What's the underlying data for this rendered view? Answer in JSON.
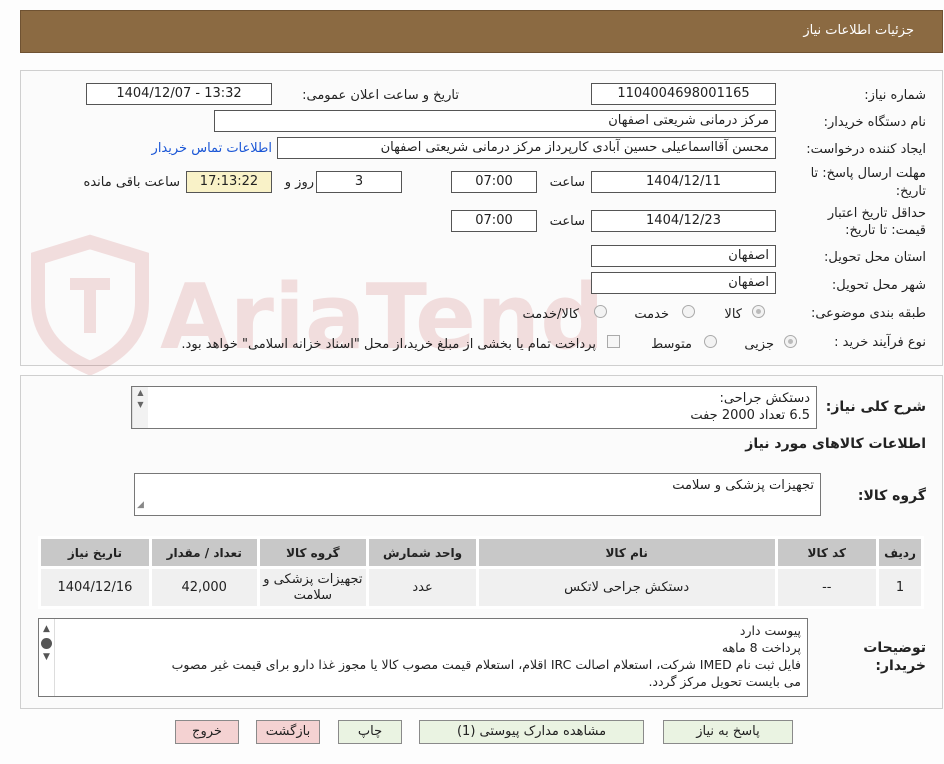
{
  "header": {
    "title": "جزئیات اطلاعات نیاز"
  },
  "watermark": {
    "text": "AriaTender.neT"
  },
  "form": {
    "need_number_label": "شماره نیاز:",
    "need_number": "1104004698001165",
    "announce_label": "تاریخ و ساعت اعلان عمومی:",
    "announce_value": "1404/12/07 - 13:32",
    "buyer_label": "نام دستگاه خریدار:",
    "buyer_value": "مرکز درمانی شریعتی اصفهان",
    "creator_label": "ایجاد کننده درخواست:",
    "creator_value": "محسن آقااسماعیلی حسین آبادی کارپرداز مرکز درمانی شریعتی اصفهان",
    "contact_link": "اطلاعات تماس خریدار",
    "deadline_label_1": "مهلت ارسال پاسخ: تا",
    "deadline_label_2": "تاریخ:",
    "deadline_date": "1404/12/11",
    "time_label": "ساعت",
    "deadline_time": "07:00",
    "days_value": "3",
    "days_label": "روز و",
    "remaining_time": "17:13:22",
    "remaining_label": "ساعت باقی مانده",
    "validity_label_1": "حداقل تاریخ اعتبار",
    "validity_label_2": "قیمت: تا تاریخ:",
    "validity_date": "1404/12/23",
    "validity_time": "07:00",
    "province_label": "استان محل تحویل:",
    "province_value": "اصفهان",
    "city_label": "شهر محل تحویل:",
    "city_value": "اصفهان",
    "category_label": "طبقه بندی موضوعی:",
    "category_options": [
      "کالا",
      "خدمت",
      "کالا/خدمت"
    ],
    "purchase_label": "نوع فرآیند خرید :",
    "purchase_options": [
      "جزیی",
      "متوسط"
    ],
    "payment_text": "پرداخت تمام یا بخشی از مبلغ خرید،از محل \"اسناد خزانه اسلامی\" خواهد بود."
  },
  "summary": {
    "label": "شرح کلی نیاز:",
    "lines": [
      "دستکش جراحی:",
      "6.5 تعداد 2000 جفت"
    ]
  },
  "goods_section": {
    "title": "اطلاعات کالاهای مورد نیاز",
    "group_label": "گروه کالا:",
    "group_value": "تجهیزات پزشکی و سلامت"
  },
  "table": {
    "headers": [
      "ردیف",
      "کد کالا",
      "نام کالا",
      "واحد شمارش",
      "گروه کالا",
      "تعداد / مقدار",
      "تاریخ نیاز"
    ],
    "rows": [
      {
        "row": "1",
        "code": "--",
        "name": "دستکش جراحی لاتکس",
        "unit": "عدد",
        "group": "تجهیزات پزشکی و سلامت",
        "qty": "42,000",
        "date": "1404/12/16"
      }
    ]
  },
  "buyer_notes": {
    "label_1": "توضیحات",
    "label_2": "خریدار:",
    "lines": [
      "پیوست دارد",
      "پرداخت 8 ماهه",
      "فایل ثبت نام IMED شرکت، استعلام اصالت IRC اقلام، استعلام قیمت مصوب کالا یا مجوز غذا دارو برای قیمت غیر مصوب",
      "می بایست تحویل مرکز گردد."
    ]
  },
  "buttons": {
    "reply": "پاسخ به نیاز",
    "attachments": "مشاهده مدارک پیوستی (1)",
    "print": "چاپ",
    "back": "بازگشت",
    "exit": "خروج"
  }
}
